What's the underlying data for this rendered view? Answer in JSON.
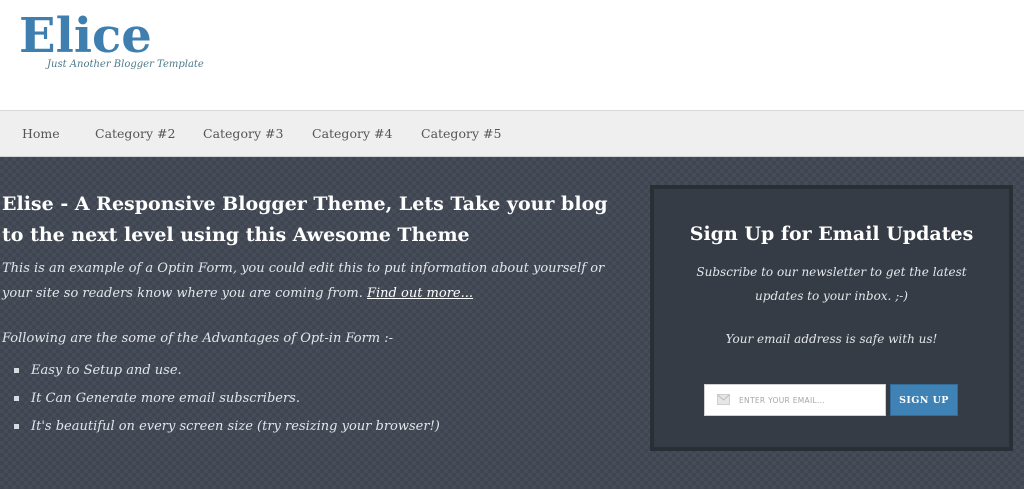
{
  "header": {
    "logo_title": "Elice",
    "logo_subtitle": "Just Another Blogger Template"
  },
  "nav": {
    "items": [
      {
        "label": "Home"
      },
      {
        "label": "Category #2"
      },
      {
        "label": "Category #3"
      },
      {
        "label": "Category #4"
      },
      {
        "label": "Category #5"
      }
    ]
  },
  "hero": {
    "title": "Elise - A Responsive Blogger Theme, Lets Take your blog to the next level using this Awesome Theme",
    "description": "This is an example of a Optin Form, you could edit this to put information about yourself or your site so readers know where you are coming from.",
    "link_text": "Find out more...",
    "following": "Following are the some of the Advantages of Opt-in Form :-",
    "advantages": [
      "Easy to Setup and use.",
      "It Can Generate more email subscribers.",
      "It's beautiful on every screen size (try resizing your browser!)"
    ]
  },
  "signup": {
    "title": "Sign Up for Email Updates",
    "description": "Subscribe to our newsletter to get the latest updates to your inbox. ;-)",
    "safe_text": "Your email address is safe with us!",
    "email_placeholder": "ENTER YOUR EMAIL...",
    "email_value": "",
    "button_label": "SIGN UP",
    "mail_icon": "envelope-icon"
  },
  "colors": {
    "logo": "#3e7fb0",
    "hero_bg": "#3f4652",
    "signup_box": "#363c45",
    "button": "#3f82b5"
  }
}
